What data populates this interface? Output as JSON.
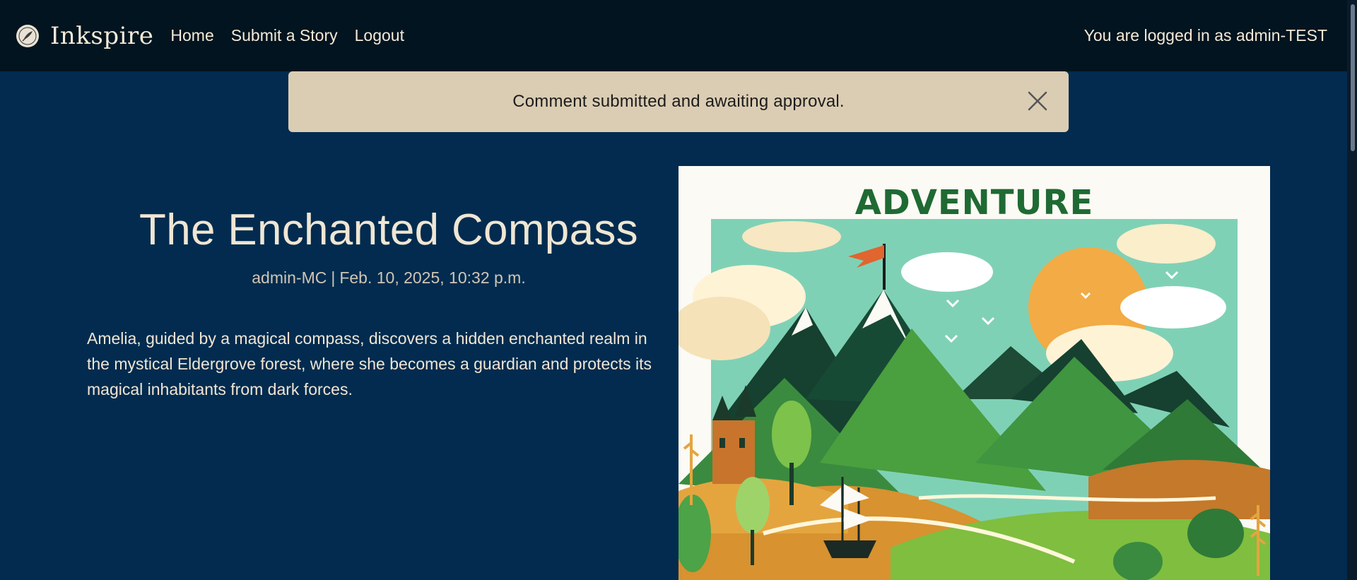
{
  "nav": {
    "brand": "Inkspire",
    "links": [
      {
        "label": "Home"
      },
      {
        "label": "Submit a Story"
      },
      {
        "label": "Logout"
      }
    ],
    "user_status": "You are logged in as admin-TEST"
  },
  "alert": {
    "message": "Comment submitted and awaiting approval.",
    "close_icon": "close-icon"
  },
  "story": {
    "title": "The Enchanted Compass",
    "author": "admin-MC",
    "separator": "|",
    "date": "Feb. 10, 2025, 10:32 p.m.",
    "excerpt": "Amelia, guided by a magical compass, discovers a hidden enchanted realm in the mystical Eldergrove forest, where she becomes a guardian and protects its magical inhabitants from dark forces.",
    "image_caption": "ADVENTURE"
  },
  "colors": {
    "navbar_bg": "#02141f",
    "page_bg": "#022b4f",
    "alert_bg": "#dbcdb3",
    "text_cream": "#efe6d3"
  },
  "icons": {
    "brand": "quill-feather-icon",
    "close": "close-icon"
  }
}
